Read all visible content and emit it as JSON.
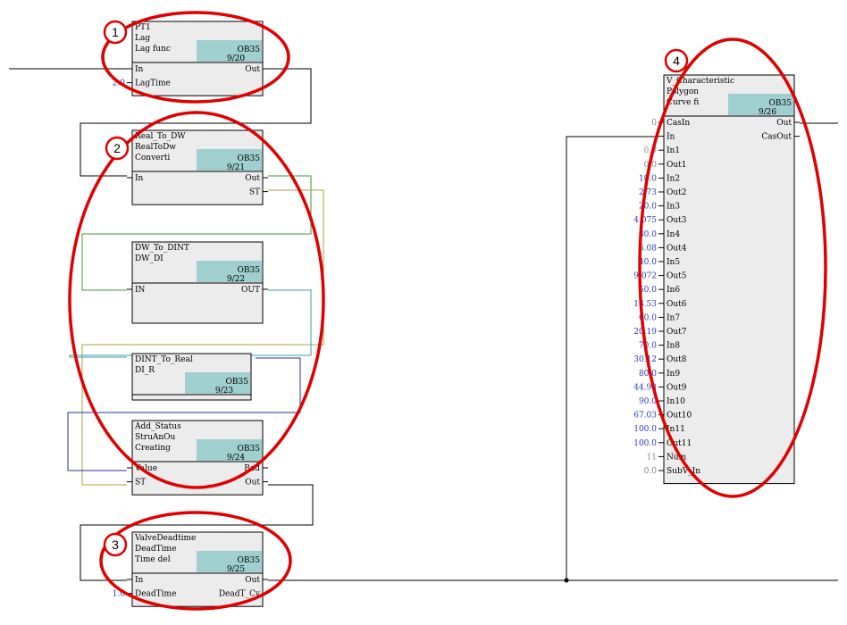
{
  "blocks": [
    {
      "id": "pt1",
      "lines": [
        "PT1",
        "Lag",
        "Lag func"
      ],
      "ob": "OB35",
      "seq": "9/20",
      "in_ports": [
        {
          "name": "In"
        },
        {
          "name": "LagTime",
          "value": "2.0"
        }
      ],
      "out_ports": [
        "Out"
      ]
    },
    {
      "id": "real-to-dw",
      "lines": [
        "Real_To_DW",
        "RealToDw",
        "Converti"
      ],
      "ob": "OB35",
      "seq": "9/21",
      "in_ports": [
        {
          "name": "In"
        }
      ],
      "out_ports": [
        "Out",
        "ST"
      ]
    },
    {
      "id": "dw-to-dint",
      "lines": [
        "DW_To_DINT",
        "DW_DI"
      ],
      "ob": "OB35",
      "seq": "9/22",
      "in_ports": [
        {
          "name": "IN"
        }
      ],
      "out_ports": [
        "OUT"
      ]
    },
    {
      "id": "dint-to-real",
      "lines": [
        "DINT_To_Real",
        "DI_R"
      ],
      "ob": "OB35",
      "seq": "9/23",
      "in_ports": [],
      "out_ports": []
    },
    {
      "id": "add-status",
      "lines": [
        "Add_Status",
        "StruAnOu",
        "Creating"
      ],
      "ob": "OB35",
      "seq": "9/24",
      "in_ports": [
        {
          "name": "Value"
        },
        {
          "name": "ST"
        }
      ],
      "out_ports": [
        "Bad",
        "Out"
      ]
    },
    {
      "id": "valve-deadtime",
      "lines": [
        "ValveDeadtime",
        "DeadTime",
        "Time del"
      ],
      "ob": "OB35",
      "seq": "9/25",
      "in_ports": [
        {
          "name": "In"
        },
        {
          "name": "DeadTime",
          "value": "1.0"
        }
      ],
      "out_ports": [
        "Out",
        "DeadT_Cy"
      ]
    },
    {
      "id": "v-characteristic",
      "lines": [
        "V_Characteristic",
        "Polygon",
        "Curve fi"
      ],
      "ob": "OB35",
      "seq": "9/26",
      "in_ports": [
        {
          "name": "CasIn",
          "value": "0"
        },
        {
          "name": "In"
        },
        {
          "name": "In1",
          "value": "0.0"
        },
        {
          "name": "Out1",
          "value": "0.0"
        },
        {
          "name": "In2",
          "value": "10.0"
        },
        {
          "name": "Out2",
          "value": "2.73"
        },
        {
          "name": "In3",
          "value": "20.0"
        },
        {
          "name": "Out3",
          "value": "4.075"
        },
        {
          "name": "In4",
          "value": "30.0"
        },
        {
          "name": "Out4",
          "value": "6.08"
        },
        {
          "name": "In5",
          "value": "40.0"
        },
        {
          "name": "Out5",
          "value": "9.072"
        },
        {
          "name": "In6",
          "value": "50.0"
        },
        {
          "name": "Out6",
          "value": "13.53"
        },
        {
          "name": "In7",
          "value": "60.0"
        },
        {
          "name": "Out7",
          "value": "20.19"
        },
        {
          "name": "In8",
          "value": "70.0"
        },
        {
          "name": "Out8",
          "value": "30.12"
        },
        {
          "name": "In9",
          "value": "80.0"
        },
        {
          "name": "Out9",
          "value": "44.93"
        },
        {
          "name": "In10",
          "value": "90.0"
        },
        {
          "name": "Out10",
          "value": "67.03"
        },
        {
          "name": "In11",
          "value": "100.0"
        },
        {
          "name": "Out11",
          "value": "100.0"
        },
        {
          "name": "Num",
          "value": "11"
        },
        {
          "name": "SubV_In",
          "value": "0.0"
        }
      ],
      "out_ports": [
        "Out",
        "CasOut"
      ]
    }
  ],
  "callouts": [
    {
      "number": "1"
    },
    {
      "number": "2"
    },
    {
      "number": "3"
    },
    {
      "number": "4"
    }
  ],
  "colors": {
    "block_fill": "#ececec",
    "header_fill": "#9fcfce",
    "wire": "#000000",
    "wire_green": "#3a9a3a",
    "wire_olive": "#a8a040",
    "wire_teal": "#3aa0a8",
    "wire_blue": "#2a30a0",
    "value_blue": "#2a38c8",
    "value_gray": "#8a8a8a",
    "callout_red": "#e00000"
  }
}
